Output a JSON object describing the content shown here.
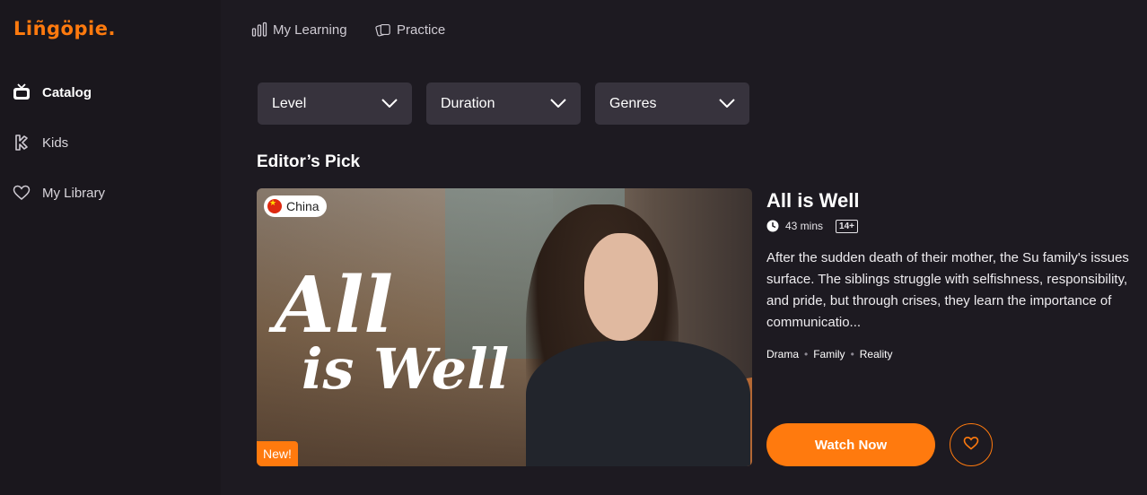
{
  "app": {
    "logo": "Liñgöpie."
  },
  "sidebar": {
    "items": [
      {
        "label": "Catalog",
        "icon": "tv-icon",
        "active": true
      },
      {
        "label": "Kids",
        "icon": "kids-icon",
        "active": false
      },
      {
        "label": "My Library",
        "icon": "heart-icon",
        "active": false
      }
    ]
  },
  "topnav": {
    "items": [
      {
        "label": "My Learning",
        "icon": "chart-bars-icon"
      },
      {
        "label": "Practice",
        "icon": "cards-icon"
      }
    ]
  },
  "filters": [
    {
      "label": "Level"
    },
    {
      "label": "Duration"
    },
    {
      "label": "Genres"
    }
  ],
  "editors_pick": {
    "section_title": "Editor’s Pick",
    "country": "China",
    "new_badge": "New!",
    "hero_text_line1": "All",
    "hero_text_line2": "is Well",
    "title": "All is Well",
    "duration": "43 mins",
    "age_rating": "14+",
    "description": "After the sudden death of their mother, the Su family's issues surface. The siblings struggle with selfishness, responsibility, and pride, but through crises, they learn the importance of communicatio...",
    "genres": [
      "Drama",
      "Family",
      "Reality"
    ],
    "watch_label": "Watch Now"
  },
  "colors": {
    "accent": "#ff7a0e",
    "background": "#1d1a21",
    "sidebar": "#1a171d",
    "filter": "#37333d"
  }
}
